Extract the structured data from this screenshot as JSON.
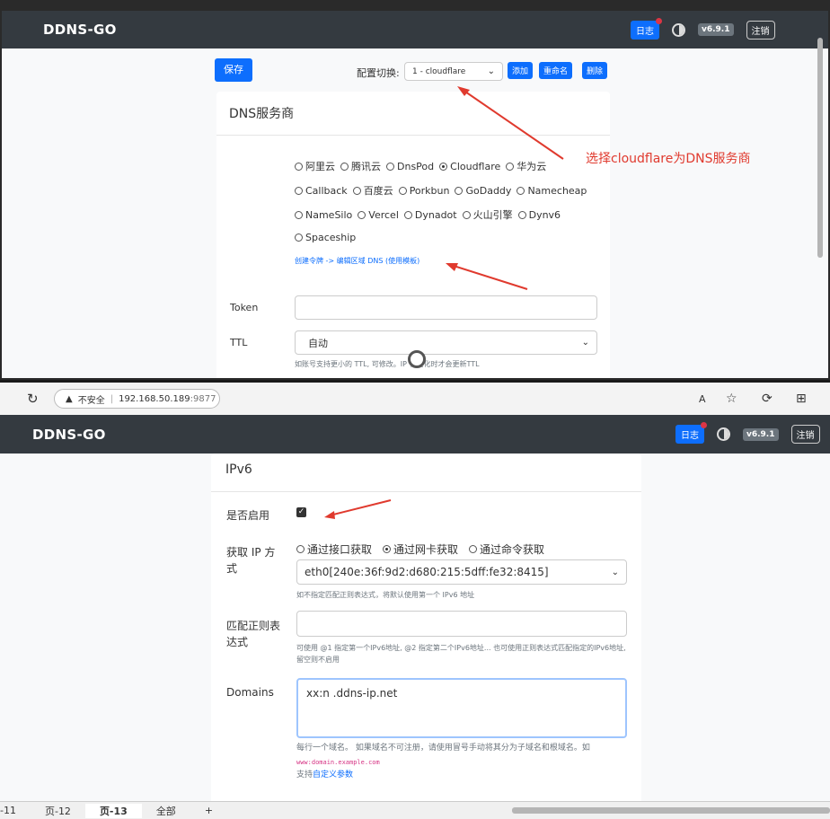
{
  "app": {
    "brand": "DDNS-GO",
    "log_label": "日志",
    "version": "v6.9.1",
    "logout_label": "注销"
  },
  "toolbar": {
    "save_label": "保存",
    "config_label": "配置切换:",
    "config_value": "1 - cloudflare",
    "add_label": "添加",
    "rename_label": "重命名",
    "delete_label": "删除"
  },
  "dns_card": {
    "title": "DNS服务商",
    "providers_row1": [
      "阿里云",
      "腾讯云",
      "DnsPod",
      "Cloudflare",
      "华为云"
    ],
    "providers_row2": [
      "Callback",
      "百度云",
      "Porkbun",
      "GoDaddy",
      "Namecheap"
    ],
    "providers_row3": [
      "NameSilo",
      "Vercel",
      "Dynadot",
      "火山引擎",
      "Dynv6"
    ],
    "providers_row4": [
      "Spaceship"
    ],
    "selected": "Cloudflare",
    "token_link": "创建令牌 -> 编辑区域 DNS (使用模板)",
    "token_label": "Token",
    "ttl_label": "TTL",
    "ttl_value": "自动",
    "ttl_help": "如账号支持更小的 TTL, 可修改。IP 有变化时才会更新TTL"
  },
  "annotation": "选择cloudflare为DNS服务商",
  "browser": {
    "insecure_label": "不安全",
    "url_host": "192.168.50.189",
    "url_port": ":9877"
  },
  "ipv6_card": {
    "title": "IPv6",
    "enable_label": "是否启用",
    "get_ip_label": "获取 IP 方式",
    "get_ip_options": [
      "通过接口获取",
      "通过网卡获取",
      "通过命令获取"
    ],
    "get_ip_selected": "通过网卡获取",
    "nic_value": "eth0[240e:36f:9d2:d680:215:5dff:fe32:8415]",
    "nic_help": "如不指定匹配正则表达式，将默认使用第一个 IPv6 地址",
    "regex_label": "匹配正则表达式",
    "regex_help": "可使用 @1 指定第一个IPv6地址, @2 指定第二个IPv6地址... 也可使用正则表达式匹配指定的IPv6地址, 留空则不启用",
    "domains_label": "Domains",
    "domains_value": "xx:n        .ddns-ip.net",
    "domains_help1": "每行一个域名。 如果域名不可注册，请使用冒号手动将其分为子域名和根域名。如",
    "domains_help_code": "www:domain.example.com",
    "domains_help2": "支持",
    "domains_help_link": "自定义参数"
  },
  "tabs": [
    "-11",
    "页-12",
    "页-13",
    "全部",
    "+"
  ],
  "colors": {
    "navbar": "#343a40",
    "primary": "#0d6efd",
    "annotation": "#e03a2e"
  }
}
